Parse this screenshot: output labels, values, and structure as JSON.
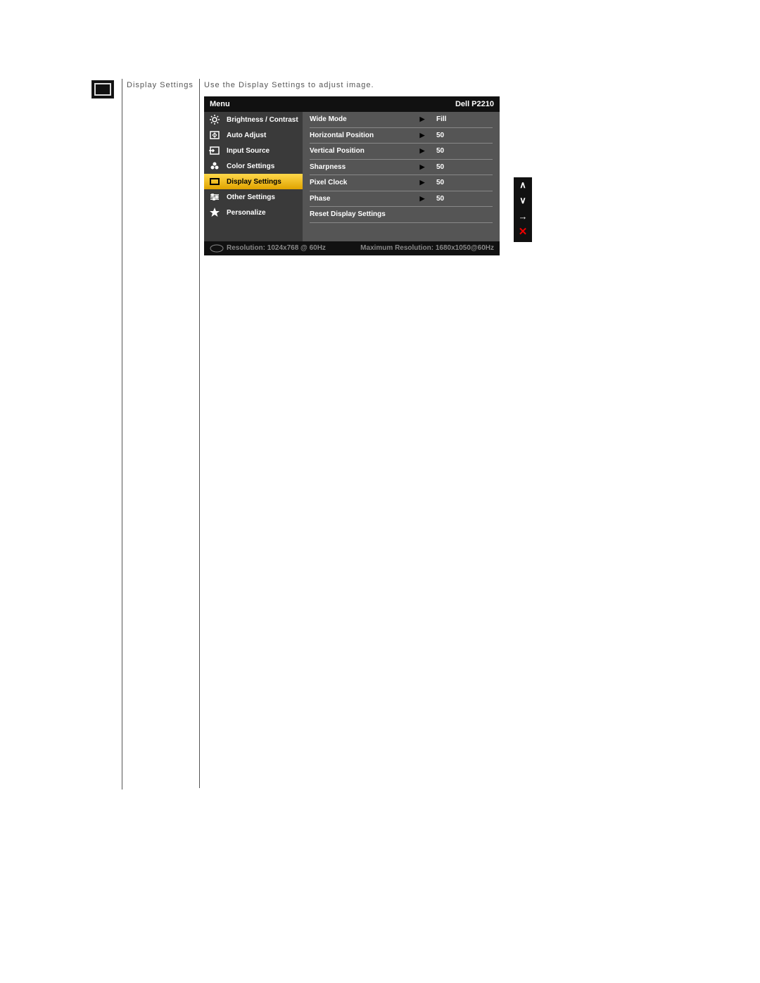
{
  "section": {
    "title": "Display Settings",
    "description": "Use the Display Settings to adjust image."
  },
  "osd": {
    "header": {
      "menu": "Menu",
      "model": "Dell P2210"
    },
    "left_items": [
      {
        "icon": "sun-icon",
        "label": "Brightness / Contrast",
        "selected": false
      },
      {
        "icon": "auto-icon",
        "label": "Auto Adjust",
        "selected": false
      },
      {
        "icon": "input-icon",
        "label": "Input Source",
        "selected": false
      },
      {
        "icon": "color-icon",
        "label": "Color Settings",
        "selected": false
      },
      {
        "icon": "display-icon",
        "label": "Display Settings",
        "selected": true
      },
      {
        "icon": "sliders-icon",
        "label": "Other Settings",
        "selected": false
      },
      {
        "icon": "star-icon",
        "label": "Personalize",
        "selected": false
      }
    ],
    "settings": [
      {
        "label": "Wide Mode",
        "value": "Fill",
        "arrow": true
      },
      {
        "label": "Horizontal Position",
        "value": "50",
        "arrow": true
      },
      {
        "label": "Vertical Position",
        "value": "50",
        "arrow": true
      },
      {
        "label": "Sharpness",
        "value": "50",
        "arrow": true
      },
      {
        "label": "Pixel Clock",
        "value": "50",
        "arrow": true
      },
      {
        "label": "Phase",
        "value": "50",
        "arrow": true
      },
      {
        "label": "Reset Display Settings",
        "value": "",
        "arrow": false
      }
    ],
    "footer": {
      "resolution": "Resolution: 1024x768 @ 60Hz",
      "max": "Maximum Resolution: 1680x1050@60Hz"
    }
  },
  "side_buttons": {
    "up": "∧",
    "down": "∨",
    "enter": "→",
    "exit": "✕"
  }
}
